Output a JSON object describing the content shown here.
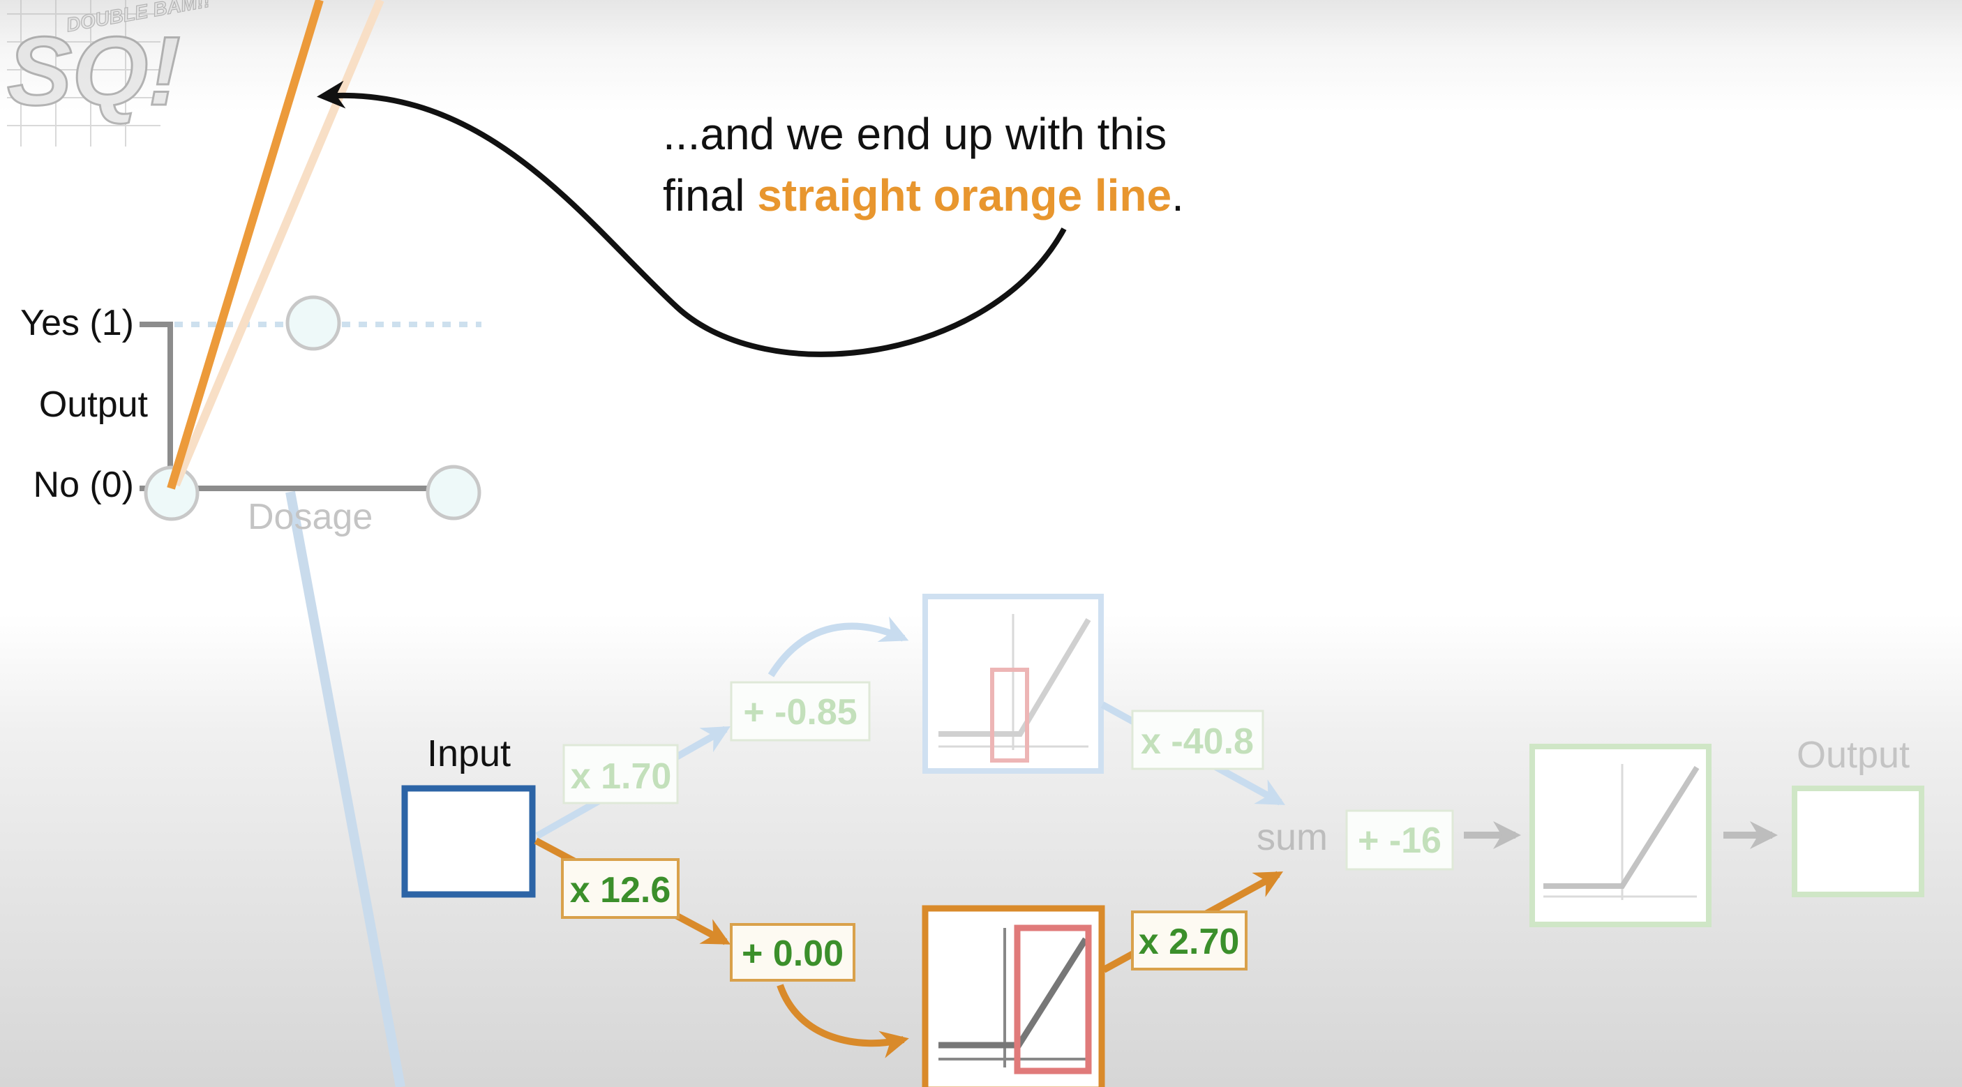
{
  "logo": {
    "text": "SQ!",
    "subtext": "DOUBLE BAM!!"
  },
  "caption": {
    "line1": "...and we end up with this",
    "line2_prefix": "final ",
    "line2_highlight": "straight orange line",
    "line2_suffix": "."
  },
  "graph": {
    "y_top_label": "Yes (1)",
    "y_axis_label": "Output",
    "y_bottom_label": "No (0)",
    "x_axis_label": "Dosage"
  },
  "network": {
    "input_label": "Input",
    "output_label": "Output",
    "top_weight": "x 1.70",
    "top_bias": "+ -0.85",
    "top_out_weight": "x -40.8",
    "bottom_weight": "x 12.6",
    "bottom_bias": "+ 0.00",
    "bottom_out_weight": "x 2.70",
    "sum_label": "sum",
    "final_bias": "+ -16"
  },
  "colors": {
    "orange": "#e8962e",
    "orange_faded": "#f7dcc0",
    "blue": "#2c64a6",
    "blue_faded": "#c8dcef",
    "green_text": "#3b9a2b",
    "green_faded": "#c9e6c0",
    "red_box": "#e07a7a",
    "gray_axis": "#8c8c8c"
  },
  "icons": [
    "statquest-logo-icon",
    "curved-arrow-icon",
    "relu-activation-icon",
    "arrow-right-icon"
  ]
}
